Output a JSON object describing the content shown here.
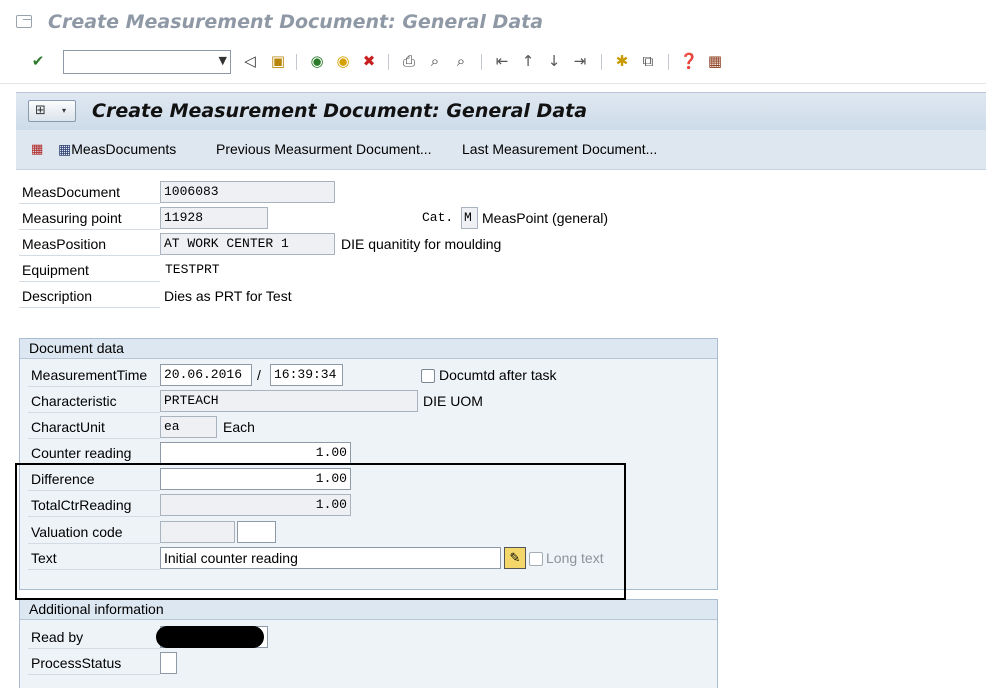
{
  "window": {
    "title": "Create Measurement Document: General Data"
  },
  "toolbar": {
    "command_field_value": "",
    "icons": [
      "check-icon",
      "back-icon",
      "save-icon",
      "back-circle-icon",
      "exit-icon",
      "cancel-icon",
      "print-icon",
      "find-icon",
      "find-next-icon",
      "first-page-icon",
      "prev-page-icon",
      "next-page-icon",
      "last-page-icon",
      "new-session-icon",
      "shortcut-icon",
      "help-icon",
      "layout-icon"
    ]
  },
  "page": {
    "title": "Create Measurement Document: General Data"
  },
  "app_toolbar": {
    "meas_documents": "MeasDocuments",
    "prev_doc": "Previous Measurment Document...",
    "last_doc": "Last Measurement Document..."
  },
  "header": {
    "meas_document": {
      "label": "MeasDocument",
      "value": "1006083"
    },
    "measuring_point": {
      "label": "Measuring point",
      "value": "11928"
    },
    "category": {
      "label": "Cat.",
      "value": "M",
      "desc": "MeasPoint (general)"
    },
    "meas_position": {
      "label": "MeasPosition",
      "value": "AT WORK CENTER 1",
      "desc": "DIE quanitity for moulding"
    },
    "equipment": {
      "label": "Equipment",
      "value": "TESTPRT"
    },
    "description": {
      "label": "Description",
      "value": "Dies as PRT for Test"
    }
  },
  "document_data": {
    "title": "Document data",
    "measurement_time": {
      "label": "MeasurementTime",
      "date": "20.06.2016",
      "sep": "/",
      "time": "16:39:34"
    },
    "documented_after_task": {
      "label": "Documtd after task",
      "checked": false
    },
    "characteristic": {
      "label": "Characteristic",
      "value": "PRTEACH",
      "desc": "DIE UOM"
    },
    "charact_unit": {
      "label": "CharactUnit",
      "value": "ea",
      "desc": "Each"
    },
    "counter_reading": {
      "label": "Counter reading",
      "value": "1.00"
    },
    "difference": {
      "label": "Difference",
      "value": "1.00"
    },
    "total_ctr_reading": {
      "label": "TotalCtrReading",
      "value": "1.00"
    },
    "valuation_code": {
      "label": "Valuation code",
      "value": "",
      "value2": ""
    },
    "text": {
      "label": "Text",
      "value": "Initial counter reading"
    },
    "long_text": {
      "label": "Long text",
      "checked": false
    }
  },
  "additional_info": {
    "title": "Additional information",
    "read_by": {
      "label": "Read by",
      "value": ""
    },
    "process_status": {
      "label": "ProcessStatus",
      "value": ""
    }
  }
}
